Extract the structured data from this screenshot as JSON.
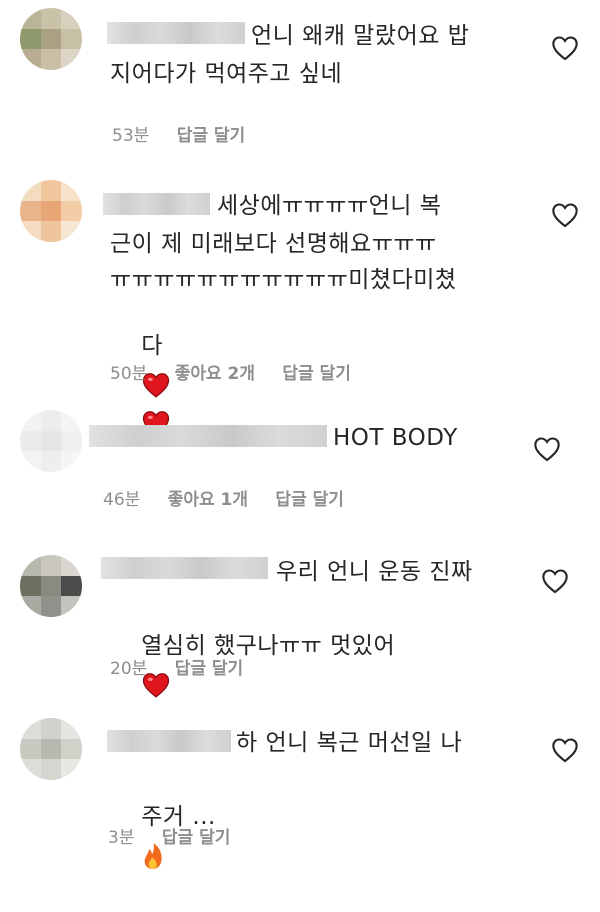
{
  "comments": [
    {
      "text_lines": [
        "언니 왜캐 말랐어요 밥",
        "지어다가 먹여주고 싶네"
      ],
      "time": "53분",
      "likes": "",
      "reply": "답글 달기",
      "like_icon": "heart-outline-icon"
    },
    {
      "text_lines": [
        "세상에ㅠㅠㅠㅠ언니 복",
        "근이 제 미래보다 선명해요ㅠㅠㅠ",
        "ㅠㅠㅠㅠㅠㅠㅠㅠㅠㅠㅠ미쳤다미쳤",
        "다"
      ],
      "emoji": [
        "red-heart-emoji",
        "red-heart-emoji"
      ],
      "time": "50분",
      "likes": "좋아요 2개",
      "reply": "답글 달기",
      "like_icon": "heart-outline-icon"
    },
    {
      "text_lines": [
        "HOT BODY"
      ],
      "time": "46분",
      "likes": "좋아요 1개",
      "reply": "답글 달기",
      "like_icon": "heart-outline-icon"
    },
    {
      "text_lines": [
        "우리 언니 운동 진짜",
        "열심히 했구나ㅠㅠ 멋있어"
      ],
      "emoji": [
        "red-heart-emoji"
      ],
      "time": "20분",
      "likes": "",
      "reply": "답글 달기",
      "like_icon": "heart-outline-icon"
    },
    {
      "text_lines": [
        "하 언니 복근 머선일 나",
        "주거 ..."
      ],
      "emoji": [
        "fire-emoji"
      ],
      "time": "3분",
      "likes": "",
      "reply": "답글 달기",
      "like_icon": "heart-outline-icon"
    }
  ]
}
